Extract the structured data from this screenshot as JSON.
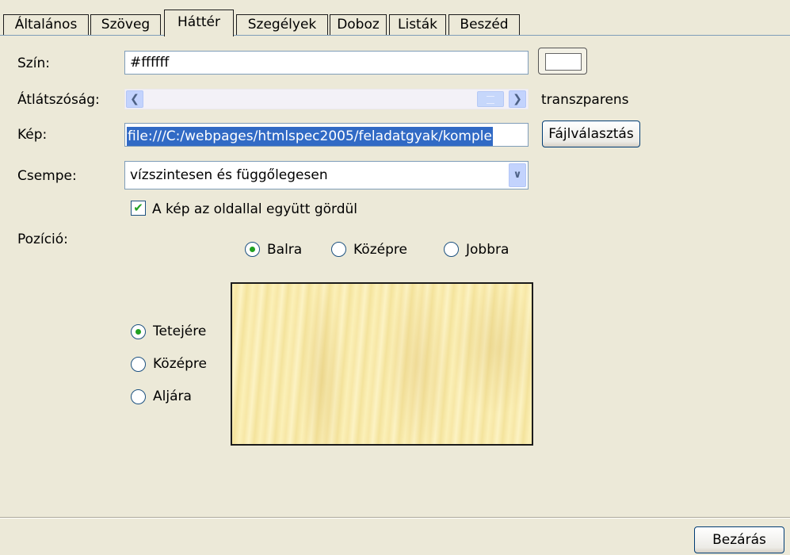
{
  "tabs": [
    {
      "label": "Általános"
    },
    {
      "label": "Szöveg"
    },
    {
      "label": "Háttér"
    },
    {
      "label": "Szegélyek"
    },
    {
      "label": "Doboz"
    },
    {
      "label": "Listák"
    },
    {
      "label": "Beszéd"
    }
  ],
  "active_tab": "Háttér",
  "color": {
    "label": "Szín:",
    "value": "#ffffff",
    "swatch_color": "#ffffff"
  },
  "transparency": {
    "label": "Átlátszóság:",
    "value_text": "transzparens"
  },
  "image": {
    "label": "Kép:",
    "value": "file:///C:/webpages/htmlspec2005/feladatgyak/komple",
    "browse_label": "Fájlválasztás"
  },
  "tile": {
    "label": "Csempe:",
    "selected": "vízszintesen és függőlegesen"
  },
  "scroll_checkbox": {
    "label": "A kép az oldallal együtt gördül",
    "checked": true
  },
  "position": {
    "label": "Pozíció:",
    "horizontal": [
      {
        "label": "Balra",
        "selected": true
      },
      {
        "label": "Középre",
        "selected": false
      },
      {
        "label": "Jobbra",
        "selected": false
      }
    ],
    "vertical": [
      {
        "label": "Tetejére",
        "selected": true
      },
      {
        "label": "Középre",
        "selected": false
      },
      {
        "label": "Aljára",
        "selected": false
      }
    ]
  },
  "close_button": "Bezárás"
}
